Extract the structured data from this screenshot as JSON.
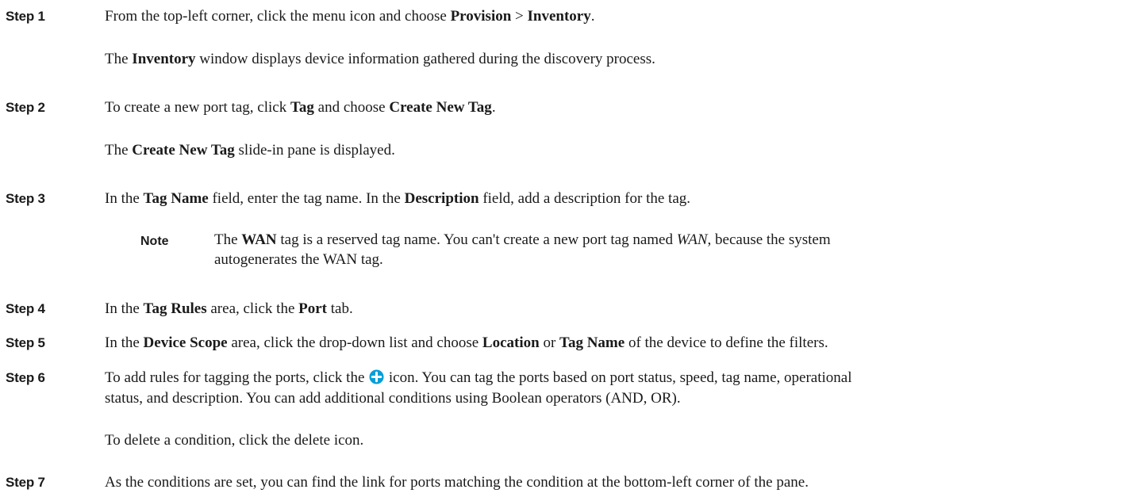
{
  "steps": [
    {
      "label": "Step 1",
      "line": [
        {
          "t": "From the top-left corner, click the menu icon and choose "
        },
        {
          "t": "Provision",
          "b": true
        },
        {
          "t": " > "
        },
        {
          "t": "Inventory",
          "b": true
        },
        {
          "t": "."
        }
      ],
      "result": [
        {
          "t": "The "
        },
        {
          "t": "Inventory",
          "b": true
        },
        {
          "t": " window displays device information gathered during the discovery process."
        }
      ]
    },
    {
      "label": "Step 2",
      "line": [
        {
          "t": "To create a new port tag, click "
        },
        {
          "t": "Tag",
          "b": true
        },
        {
          "t": " and choose "
        },
        {
          "t": "Create New Tag",
          "b": true
        },
        {
          "t": "."
        }
      ],
      "result": [
        {
          "t": "The "
        },
        {
          "t": "Create New Tag",
          "b": true
        },
        {
          "t": " slide-in pane is displayed."
        }
      ]
    },
    {
      "label": "Step 3",
      "line": [
        {
          "t": "In the "
        },
        {
          "t": "Tag Name",
          "b": true
        },
        {
          "t": " field, enter the tag name. In the "
        },
        {
          "t": "Description",
          "b": true
        },
        {
          "t": " field, add a description for the tag."
        }
      ],
      "note": {
        "label": "Note",
        "line1": [
          {
            "t": "The "
          },
          {
            "t": "WAN",
            "b": true
          },
          {
            "t": " tag is a reserved tag name. You can't create a new port tag named "
          },
          {
            "t": "WAN",
            "i": true
          },
          {
            "t": ", because the system"
          }
        ],
        "line2": [
          {
            "t": "autogenerates the WAN tag."
          }
        ]
      }
    },
    {
      "label": "Step 4",
      "line": [
        {
          "t": "In the "
        },
        {
          "t": "Tag Rules",
          "b": true
        },
        {
          "t": " area, click the "
        },
        {
          "t": "Port",
          "b": true
        },
        {
          "t": " tab."
        }
      ]
    },
    {
      "label": "Step 5",
      "line": [
        {
          "t": "In the "
        },
        {
          "t": "Device Scope",
          "b": true
        },
        {
          "t": " area, click the drop-down list and choose "
        },
        {
          "t": "Location",
          "b": true
        },
        {
          "t": " or "
        },
        {
          "t": "Tag Name",
          "b": true
        },
        {
          "t": " of the device to define the filters."
        }
      ]
    },
    {
      "label": "Step 6",
      "line": [
        {
          "t": "To add rules for tagging the ports, click the "
        },
        {
          "icon": "plus-circle-icon"
        },
        {
          "t": " icon. You can tag the ports based on port status, speed, tag name, operational"
        }
      ],
      "line2": [
        {
          "t": "status, and description. You can add additional conditions using Boolean operators (AND, OR)."
        }
      ],
      "result": [
        {
          "t": "To delete a condition, click the delete icon."
        }
      ]
    },
    {
      "label": "Step 7",
      "line": [
        {
          "t": "As the conditions are set, you can find the link for ports matching the condition at the bottom-left corner of the pane."
        }
      ]
    }
  ],
  "colors": {
    "text": "#1a1a1a",
    "icon": "#049fd9"
  }
}
